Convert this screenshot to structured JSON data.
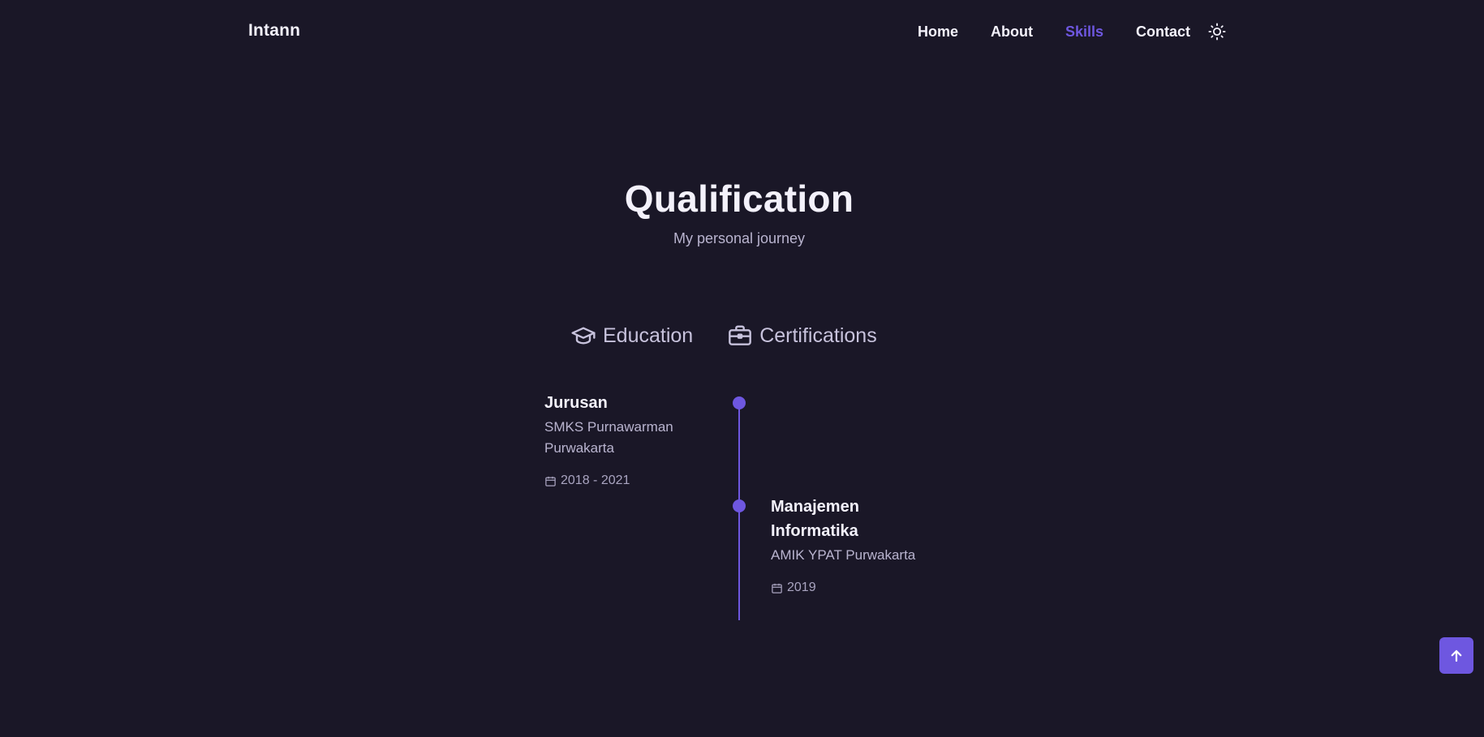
{
  "header": {
    "logo": "Intann",
    "nav": [
      {
        "label": "Home",
        "active": false
      },
      {
        "label": "About",
        "active": false
      },
      {
        "label": "Skills",
        "active": true
      },
      {
        "label": "Contact",
        "active": false
      }
    ],
    "theme_icon": "sun-icon"
  },
  "section": {
    "title": "Qualification",
    "subtitle": "My personal journey"
  },
  "tabs": [
    {
      "label": "Education",
      "icon": "graduation-cap-icon"
    },
    {
      "label": "Certifications",
      "icon": "briefcase-icon"
    }
  ],
  "timeline": [
    {
      "title": "Jurusan",
      "subtitle": "SMKS Purnawarman Purwakarta",
      "date": "2018 - 2021",
      "side": "left"
    },
    {
      "title": "Manajemen Informatika",
      "subtitle": "AMIK YPAT Purwakarta",
      "date": "2019",
      "side": "right"
    }
  ],
  "scroll_up_icon": "arrow-up-icon",
  "colors": {
    "background": "#1a1727",
    "accent": "#6e57e0",
    "text": "#f3f1fb",
    "muted": "#b9b4cf"
  }
}
